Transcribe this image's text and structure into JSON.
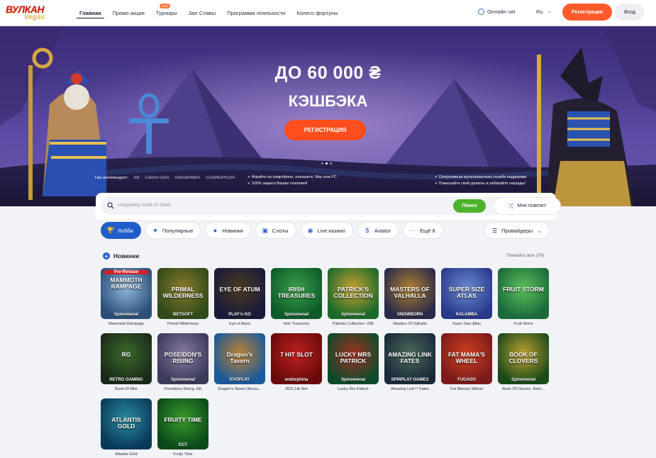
{
  "header": {
    "logo": {
      "line1": "ВУЛКАН",
      "line2": "Vegas"
    },
    "nav": [
      {
        "label": "Главная",
        "active": true
      },
      {
        "label": "Промо акции"
      },
      {
        "label": "Турниры",
        "badge": "NEW"
      },
      {
        "label": "Зал Славы"
      },
      {
        "label": "Программа лояльности"
      },
      {
        "label": "Колесо фортуны"
      }
    ],
    "chat_label": "Онлайн чат",
    "lang": "Ru",
    "register_label": "Регистрация",
    "login_label": "Вход"
  },
  "hero": {
    "title_line1": "ДО 60 000 ₴",
    "title_line2": "КЭШБЭКА",
    "cta_label": "РЕГИСТРАЦИЯ",
    "recommended_label": "Нас рекомендуют:",
    "partner_logos": [
      "lcb",
      "Casino Guru",
      "AskGamblers",
      "CASINOPEDIA"
    ],
    "features_left": [
      "Играйте на смартфоне, планшете, Mac или PC",
      "100% защита Ваших платежей"
    ],
    "features_right": [
      "Оперативная мультиязычная служба поддержки",
      "Повышайте свой уровень и забирайте награды!"
    ],
    "slides": 3,
    "active_slide": 2
  },
  "search": {
    "placeholder": "например book of dead",
    "button_label": "Поиск",
    "lucky_label": "Мне повезет"
  },
  "categories": [
    {
      "label": "Лобби",
      "icon": "trophy-icon",
      "active": true
    },
    {
      "label": "Популярные",
      "icon": "heart-icon"
    },
    {
      "label": "Новинки",
      "icon": "plus-icon"
    },
    {
      "label": "Слоты",
      "icon": "slots-icon"
    },
    {
      "label": "Live казино",
      "icon": "live-icon"
    },
    {
      "label": "Aviator",
      "icon": "aviator-icon"
    },
    {
      "label": "Ещё  8",
      "icon": "more-icon"
    }
  ],
  "providers_label": "Провайдеры",
  "section": {
    "title": "Новинки",
    "show_all": "Показать все (79)"
  },
  "games": [
    {
      "name": "Mammoth Rampage",
      "art_title": "MAMMOTH RAMPAGE",
      "provider": "Spinomenal",
      "badge": "Pre-Release",
      "colors": [
        "#2a4f7a",
        "#8fb7d8"
      ]
    },
    {
      "name": "Primal Wilderness",
      "art_title": "PRIMAL WILDERNESS",
      "provider": "BETSOFT",
      "colors": [
        "#2f4a1a",
        "#8c7a2a"
      ]
    },
    {
      "name": "Eye of Atum",
      "art_title": "EYE OF ATUM",
      "provider": "PLAY'n GO",
      "colors": [
        "#1a1a3a",
        "#4a3a20"
      ]
    },
    {
      "name": "Irish Treasures",
      "art_title": "IRISH TREASURES",
      "provider": "Spinomenal",
      "colors": [
        "#0e5a2a",
        "#3aa04a"
      ]
    },
    {
      "name": "Patricks Collection -20E",
      "art_title": "PATRICK'S COLLECTION",
      "provider": "Spinomenal",
      "colors": [
        "#1a6a2a",
        "#c9a030"
      ]
    },
    {
      "name": "Masters Of Valhalla",
      "art_title": "MASTERS OF VALHALLA",
      "provider": "SNOWBORN",
      "colors": [
        "#2a2a4a",
        "#b08030"
      ]
    },
    {
      "name": "Super Size Atlas",
      "art_title": "SUPER SIZE ATLAS",
      "provider": "KALAMBA",
      "colors": [
        "#2a3a8a",
        "#6a8ad0"
      ]
    },
    {
      "name": "Fruit Storm",
      "art_title": "FRUIT STORM",
      "provider": "",
      "colors": [
        "#1a6a3a",
        "#5ac05a"
      ]
    },
    {
      "name": "Book Of Misr",
      "art_title": "RG",
      "provider": "RETRO GAMING",
      "colors": [
        "#1a2a1a",
        "#3a6a2a"
      ]
    },
    {
      "name": "Poseidons Rising -EE",
      "art_title": "POSEIDON'S RISING",
      "provider": "Spinomenal",
      "colors": [
        "#3a3a5a",
        "#8a7aa0"
      ]
    },
    {
      "name": "Dragon's Tavern Bonus...",
      "art_title": "Dragon's Tavern",
      "provider": "EVOPLAY",
      "colors": [
        "#1a5a9a",
        "#c08030"
      ]
    },
    {
      "name": "2021 Hit Slot",
      "art_title": "7 HIT SLOT",
      "provider": "endorphina",
      "colors": [
        "#6a0a0a",
        "#c02020"
      ]
    },
    {
      "name": "Lucky Mrs Patrick",
      "art_title": "LUCKY MRS PATRICK",
      "provider": "Spinomenal",
      "colors": [
        "#0e4a2a",
        "#a03020"
      ]
    },
    {
      "name": "Amazing Link™ Fates",
      "art_title": "AMAZING LINK FATES",
      "provider": "SPINPLAY GAMES",
      "colors": [
        "#1a2a3a",
        "#4a6a5a"
      ]
    },
    {
      "name": "Fat Mama's Wheel",
      "art_title": "FAT MAMA'S WHEEL",
      "provider": "FUGASO",
      "colors": [
        "#7a1a1a",
        "#d04020"
      ]
    },
    {
      "name": "Book Of Clovers -Relo...",
      "art_title": "BOOK OF CLOVERS",
      "provider": "Spinomenal",
      "colors": [
        "#1a4a1a",
        "#c0a030"
      ]
    },
    {
      "name": "Atlantis Gold",
      "art_title": "ATLANTIS GOLD",
      "provider": "",
      "colors": [
        "#0a3a5a",
        "#2a8aa0"
      ]
    },
    {
      "name": "Fruity Time",
      "art_title": "FRUITY TIME",
      "provider": "EGT",
      "colors": [
        "#0a4a1a",
        "#3a9a2a"
      ]
    }
  ]
}
